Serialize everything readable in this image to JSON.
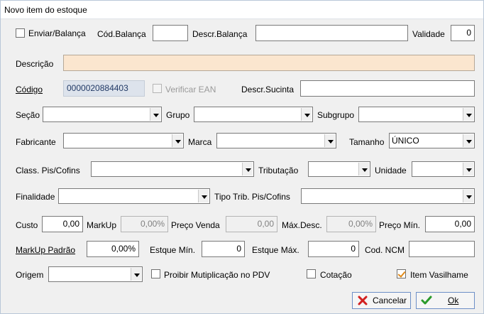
{
  "window": {
    "title": "Novo item do estoque"
  },
  "row1": {
    "enviar_balanca_label": "Enviar/Balança",
    "enviar_balanca_checked": false,
    "cod_balanca_label": "Cód.Balança",
    "cod_balanca_value": "",
    "descr_balanca_label": "Descr.Balança",
    "descr_balanca_value": "",
    "validade_label": "Validade",
    "validade_value": "0"
  },
  "descricao": {
    "label": "Descrição",
    "value": ""
  },
  "codigo_row": {
    "codigo_label": "Código",
    "codigo_value": "0000020884403",
    "verificar_ean_label": "Verificar EAN",
    "verificar_ean_checked": false,
    "descr_sucinta_label": "Descr.Sucinta",
    "descr_sucinta_value": ""
  },
  "secao_row": {
    "secao_label": "Seção",
    "secao_value": "",
    "grupo_label": "Grupo",
    "grupo_value": "",
    "subgrupo_label": "Subgrupo",
    "subgrupo_value": ""
  },
  "fabricante_row": {
    "fabricante_label": "Fabricante",
    "fabricante_value": "",
    "marca_label": "Marca",
    "marca_value": "",
    "tamanho_label": "Tamanho",
    "tamanho_value": "ÚNICO"
  },
  "class_row": {
    "class_label": "Class. Pis/Cofins",
    "class_value": "",
    "tributacao_label": "Tributação",
    "tributacao_value": "",
    "unidade_label": "Unidade",
    "unidade_value": ""
  },
  "finalidade_row": {
    "finalidade_label": "Finalidade",
    "finalidade_value": "",
    "tipo_trib_label": "Tipo Trib. Pis/Cofins",
    "tipo_trib_value": ""
  },
  "custo_row": {
    "custo_label": "Custo",
    "custo_value": "0,00",
    "markup_label": "MarkUp",
    "markup_value": "0,00%",
    "preco_venda_label": "Preço Venda",
    "preco_venda_value": "0,00",
    "max_desc_label": "Máx.Desc.",
    "max_desc_value": "0,00%",
    "preco_min_label": "Preço Mín.",
    "preco_min_value": "0,00"
  },
  "markup_row": {
    "markup_padrao_label": "MarkUp Padrão",
    "markup_padrao_value": "0,00%",
    "estque_min_label": "Estque Mín.",
    "estque_min_value": "0",
    "estque_max_label": "Estque Máx.",
    "estque_max_value": "0",
    "cod_ncm_label": "Cod. NCM",
    "cod_ncm_value": ""
  },
  "origem_row": {
    "origem_label": "Origem",
    "origem_value": "",
    "proibir_label": "Proibir Mutiplicação no PDV",
    "proibir_checked": false,
    "cotacao_label": "Cotação",
    "cotacao_checked": false,
    "item_vasilhame_label": "Item Vasilhame",
    "item_vasilhame_checked": true
  },
  "buttons": {
    "cancelar": "Cancelar",
    "ok": "Ok"
  },
  "colors": {
    "accent": "#6d8fc7",
    "descricao_bg": "#fbe6cf",
    "cancel_icon": "#d22020",
    "ok_icon": "#2a9a2a"
  }
}
